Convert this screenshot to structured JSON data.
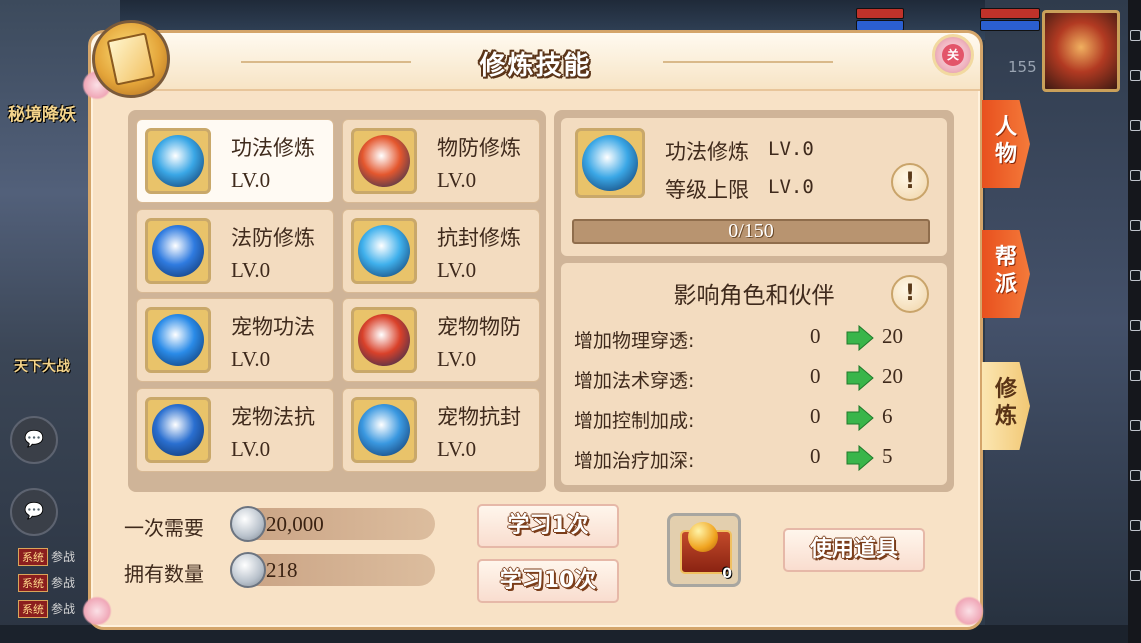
{
  "window": {
    "title": "修炼技能"
  },
  "background": {
    "left_labels": [
      "秘境降妖",
      "天下大战"
    ],
    "chat_icons": [
      "chat-icon",
      "chat-icon"
    ],
    "system_lines": [
      {
        "tag": "系统",
        "text": "参战"
      },
      {
        "tag": "系统",
        "text": "参战"
      },
      {
        "tag": "系统",
        "text": "参战"
      }
    ],
    "top_right_value": "155"
  },
  "skills": [
    {
      "name": "功法修炼",
      "level": "LV.0",
      "icon": "gongfa-orb-icon",
      "color": "#3aa7e6",
      "selected": true
    },
    {
      "name": "物防修炼",
      "level": "LV.0",
      "icon": "wufang-orb-icon",
      "color": "#e4572e",
      "selected": false
    },
    {
      "name": "法防修炼",
      "level": "LV.0",
      "icon": "fafang-orb-icon",
      "color": "#2f7be0",
      "selected": false
    },
    {
      "name": "抗封修炼",
      "level": "LV.0",
      "icon": "kangfeng-orb-icon",
      "color": "#3fb0ec",
      "selected": false
    },
    {
      "name": "宠物功法",
      "level": "LV.0",
      "icon": "pet-gongfa-orb-icon",
      "color": "#2a8be8",
      "selected": false
    },
    {
      "name": "宠物物防",
      "level": "LV.0",
      "icon": "pet-wufang-orb-icon",
      "color": "#d9412a",
      "selected": false
    },
    {
      "name": "宠物法抗",
      "level": "LV.0",
      "icon": "pet-fakang-orb-icon",
      "color": "#2a6fd0",
      "selected": false
    },
    {
      "name": "宠物抗封",
      "level": "LV.0",
      "icon": "pet-kangfeng-orb-icon",
      "color": "#3a98e0",
      "selected": false
    }
  ],
  "detail": {
    "name": "功法修炼",
    "level": "LV.0",
    "cap_label": "等级上限",
    "cap_level": "LV.0",
    "progress_text": "0/150",
    "progress_current": 0,
    "progress_max": 150,
    "affect_title": "影响角色和伙伴",
    "info_icon": "exclamation-icon"
  },
  "stats": [
    {
      "label": "增加物理穿透:",
      "from": "0",
      "to": "20"
    },
    {
      "label": "增加法术穿透:",
      "from": "0",
      "to": "20"
    },
    {
      "label": "增加控制加成:",
      "from": "0",
      "to": "6"
    },
    {
      "label": "增加治疗加深:",
      "from": "0",
      "to": "5"
    }
  ],
  "cost": {
    "need_label": "一次需要",
    "need_value": "20,000",
    "own_label": "拥有数量",
    "own_value": "218",
    "currency_icon": "silver-coin-icon"
  },
  "buttons": {
    "learn_once": "学习1次",
    "learn_ten": "学习10次",
    "use_item": "使用道具"
  },
  "item": {
    "icon": "treasure-chest-icon",
    "count": "0"
  },
  "tabs": [
    {
      "label": "人物",
      "active": false
    },
    {
      "label": "帮派",
      "active": false
    },
    {
      "label": "修炼",
      "active": true
    }
  ],
  "close": {
    "label": "关"
  },
  "colors": {
    "panel_bg": "#f8e2c6",
    "card_bg": "#f3dcc0",
    "tab_red": "#e8501e",
    "tab_active": "#f2c874",
    "arrow_green": "#39b54a"
  }
}
